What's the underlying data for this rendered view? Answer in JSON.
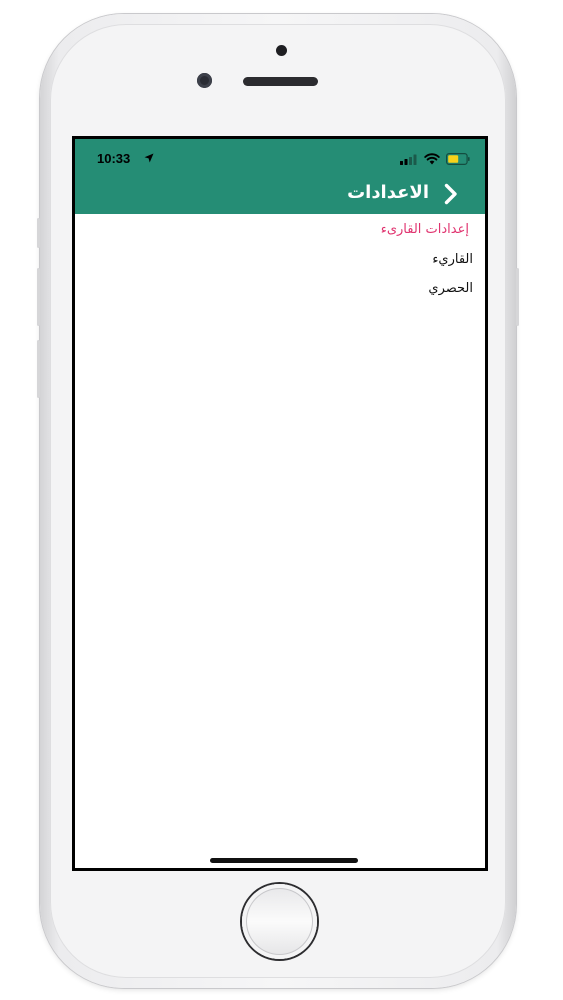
{
  "status_bar": {
    "time": "10:33",
    "location_icon": "location-arrow-icon",
    "signal_icon": "cellular-signal-icon",
    "wifi_icon": "wifi-icon",
    "battery_icon": "battery-icon",
    "battery_color": "#f7d21a"
  },
  "nav": {
    "title": "الاعدادات",
    "back_icon": "chevron-back-icon"
  },
  "settings": {
    "section_header": "إعدادات القارىء",
    "items": [
      {
        "label": "القاريء"
      },
      {
        "label": "الحصري"
      }
    ]
  },
  "colors": {
    "accent": "#258d75",
    "section_header": "#e0336f"
  }
}
